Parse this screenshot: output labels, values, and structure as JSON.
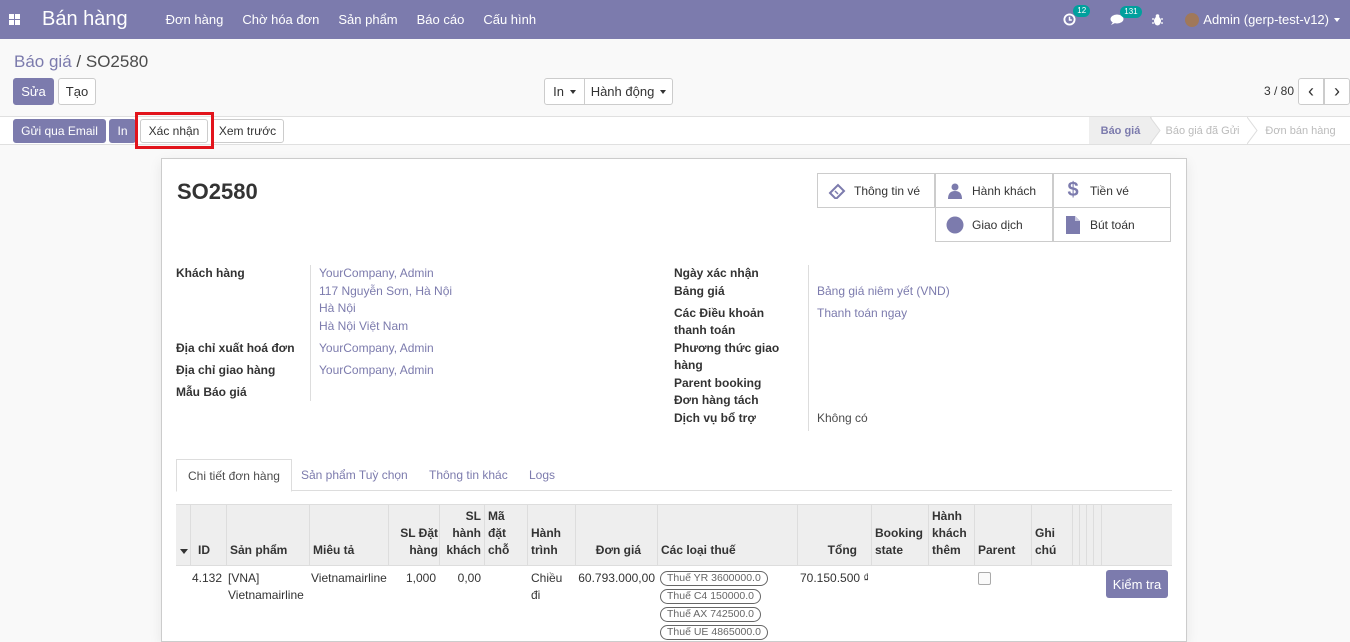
{
  "nav": {
    "brand": "Bán hàng",
    "menu": [
      "Đơn hàng",
      "Chờ hóa đơn",
      "Sản phẩm",
      "Báo cáo",
      "Cấu hình"
    ],
    "activity_count": "12",
    "message_count": "131",
    "user": "Admin (gerp-test-v12)"
  },
  "breadcrumb": {
    "parent": "Báo giá",
    "separator": "/",
    "current": "SO2580"
  },
  "buttons": {
    "edit": "Sửa",
    "create": "Tạo",
    "print": "In",
    "action": "Hành động"
  },
  "pager": {
    "value": "3 / 80",
    "prev": "‹",
    "next": "›"
  },
  "header_buttons": {
    "send_email": "Gửi qua Email",
    "print": "In",
    "confirm": "Xác nhận",
    "preview": "Xem trước"
  },
  "stages": [
    "Báo giá",
    "Báo giá đã Gửi",
    "Đơn bán hàng"
  ],
  "form": {
    "name": "SO2580",
    "smart_buttons": {
      "ticket_info": "Thông tin vé",
      "passengers": "Hành khách",
      "ticket_money": "Tiền vé",
      "transactions": "Giao dịch",
      "journal_entries": "Bút toán"
    },
    "left": {
      "customer_label": "Khách hàng",
      "customer_lines": [
        "YourCompany, Admin",
        "117 Nguyễn Sơn, Hà Nội",
        "Hà Nội",
        "Hà Nội Việt Nam"
      ],
      "invoice_address_label": "Địa chỉ xuất hoá đơn",
      "invoice_address": "YourCompany, Admin",
      "delivery_address_label": "Địa chỉ giao hàng",
      "delivery_address": "YourCompany, Admin",
      "template_label": "Mẫu Báo giá"
    },
    "right": {
      "confirm_date_label": "Ngày xác nhận",
      "pricelist_label": "Bảng giá",
      "pricelist": "Bảng giá niêm yết (VND)",
      "payment_terms_label_1": "Các Điều khoản",
      "payment_terms_label_2": "thanh toán",
      "payment_terms": "Thanh toán ngay",
      "delivery_method_label_1": "Phương thức giao",
      "delivery_method_label_2": "hàng",
      "parent_booking_label": "Parent booking",
      "split_order_label": "Đơn hàng tách",
      "addon_service_label": "Dịch vụ bổ trợ",
      "addon_service": "Không có"
    }
  },
  "tabs": [
    "Chi tiết đơn hàng",
    "Sản phẩm Tuỳ chọn",
    "Thông tin khác",
    "Logs"
  ],
  "table": {
    "headers": {
      "id": "ID",
      "product": "Sản phẩm",
      "description": "Miêu tả",
      "qty": [
        "SL Đặt",
        "hàng"
      ],
      "passenger_qty": [
        "SL",
        "hành",
        "khách"
      ],
      "booking_code": [
        "Mã",
        "đặt",
        "chỗ"
      ],
      "itinerary": [
        "Hành",
        "trình"
      ],
      "unit_price": "Đơn giá",
      "taxes": "Các loại thuế",
      "total": "Tổng",
      "booking_state": [
        "Booking",
        "state"
      ],
      "extra_passenger": [
        "Hành",
        "khách",
        "thêm"
      ],
      "parent": "Parent",
      "note": [
        "Ghi",
        "chú"
      ]
    },
    "row": {
      "id": "4.132",
      "product": [
        "[VNA]",
        "Vietnamairline"
      ],
      "description": "Vietnamairline",
      "qty": "1,000",
      "passenger_qty": "0,00",
      "itinerary": [
        "Chiều",
        "đi"
      ],
      "unit_price": "60.793.000,00",
      "taxes": [
        "Thuế YR 3600000.0",
        "Thuế C4 150000.0",
        "Thuế AX 742500.0",
        "Thuế UE 4865000.0"
      ],
      "total": "70.150.500 ₫",
      "parent_checked": false,
      "check_button": "Kiểm tra"
    }
  }
}
